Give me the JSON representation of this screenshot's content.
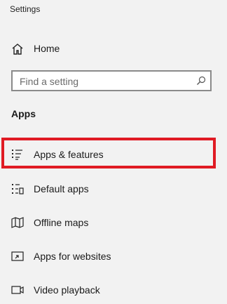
{
  "window": {
    "title": "Settings"
  },
  "home": {
    "label": "Home",
    "icon": "home-icon"
  },
  "search": {
    "placeholder": "Find a setting",
    "icon": "search-icon"
  },
  "section": {
    "title": "Apps"
  },
  "nav": {
    "items": [
      {
        "label": "Apps & features",
        "icon": "apps-features-icon",
        "selected": true
      },
      {
        "label": "Default apps",
        "icon": "default-apps-icon"
      },
      {
        "label": "Offline maps",
        "icon": "offline-maps-icon"
      },
      {
        "label": "Apps for websites",
        "icon": "apps-for-websites-icon"
      },
      {
        "label": "Video playback",
        "icon": "video-playback-icon"
      }
    ]
  },
  "colors": {
    "highlight": "#e01b24",
    "background": "#f2f2f2",
    "search_border": "#8a8a8a"
  }
}
